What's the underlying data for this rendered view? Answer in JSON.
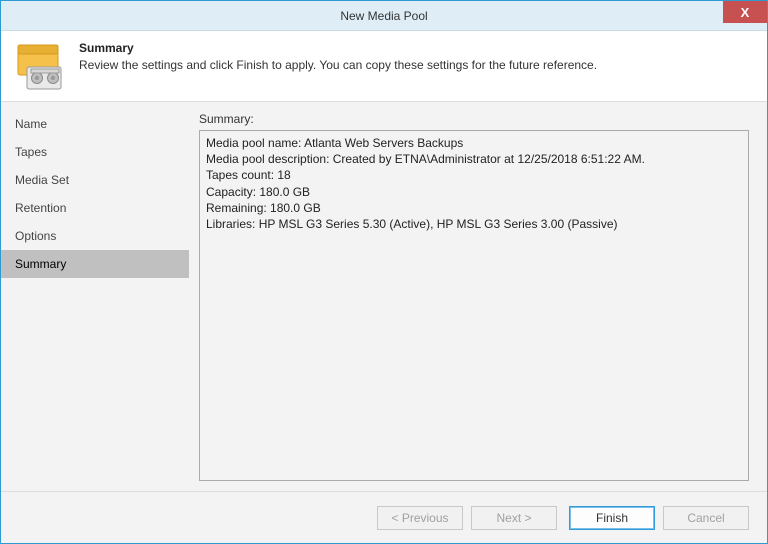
{
  "window": {
    "title": "New Media Pool"
  },
  "header": {
    "title": "Summary",
    "subtitle": "Review the settings and click Finish to apply. You can copy these settings for the future reference."
  },
  "sidebar": {
    "items": [
      {
        "label": "Name"
      },
      {
        "label": "Tapes"
      },
      {
        "label": "Media Set"
      },
      {
        "label": "Retention"
      },
      {
        "label": "Options"
      },
      {
        "label": "Summary"
      }
    ],
    "active_index": 5
  },
  "main": {
    "summary_label": "Summary:",
    "summary_lines": [
      "Media pool name: Atlanta Web Servers Backups",
      "Media pool description: Created by ETNA\\Administrator at 12/25/2018 6:51:22 AM.",
      "Tapes count: 18",
      "Capacity: 180.0 GB",
      "Remaining: 180.0 GB",
      "Libraries: HP MSL G3 Series 5.30 (Active), HP MSL G3 Series 3.00 (Passive)"
    ]
  },
  "footer": {
    "previous": "< Previous",
    "next": "Next >",
    "finish": "Finish",
    "cancel": "Cancel"
  },
  "icons": {
    "close": "X"
  }
}
